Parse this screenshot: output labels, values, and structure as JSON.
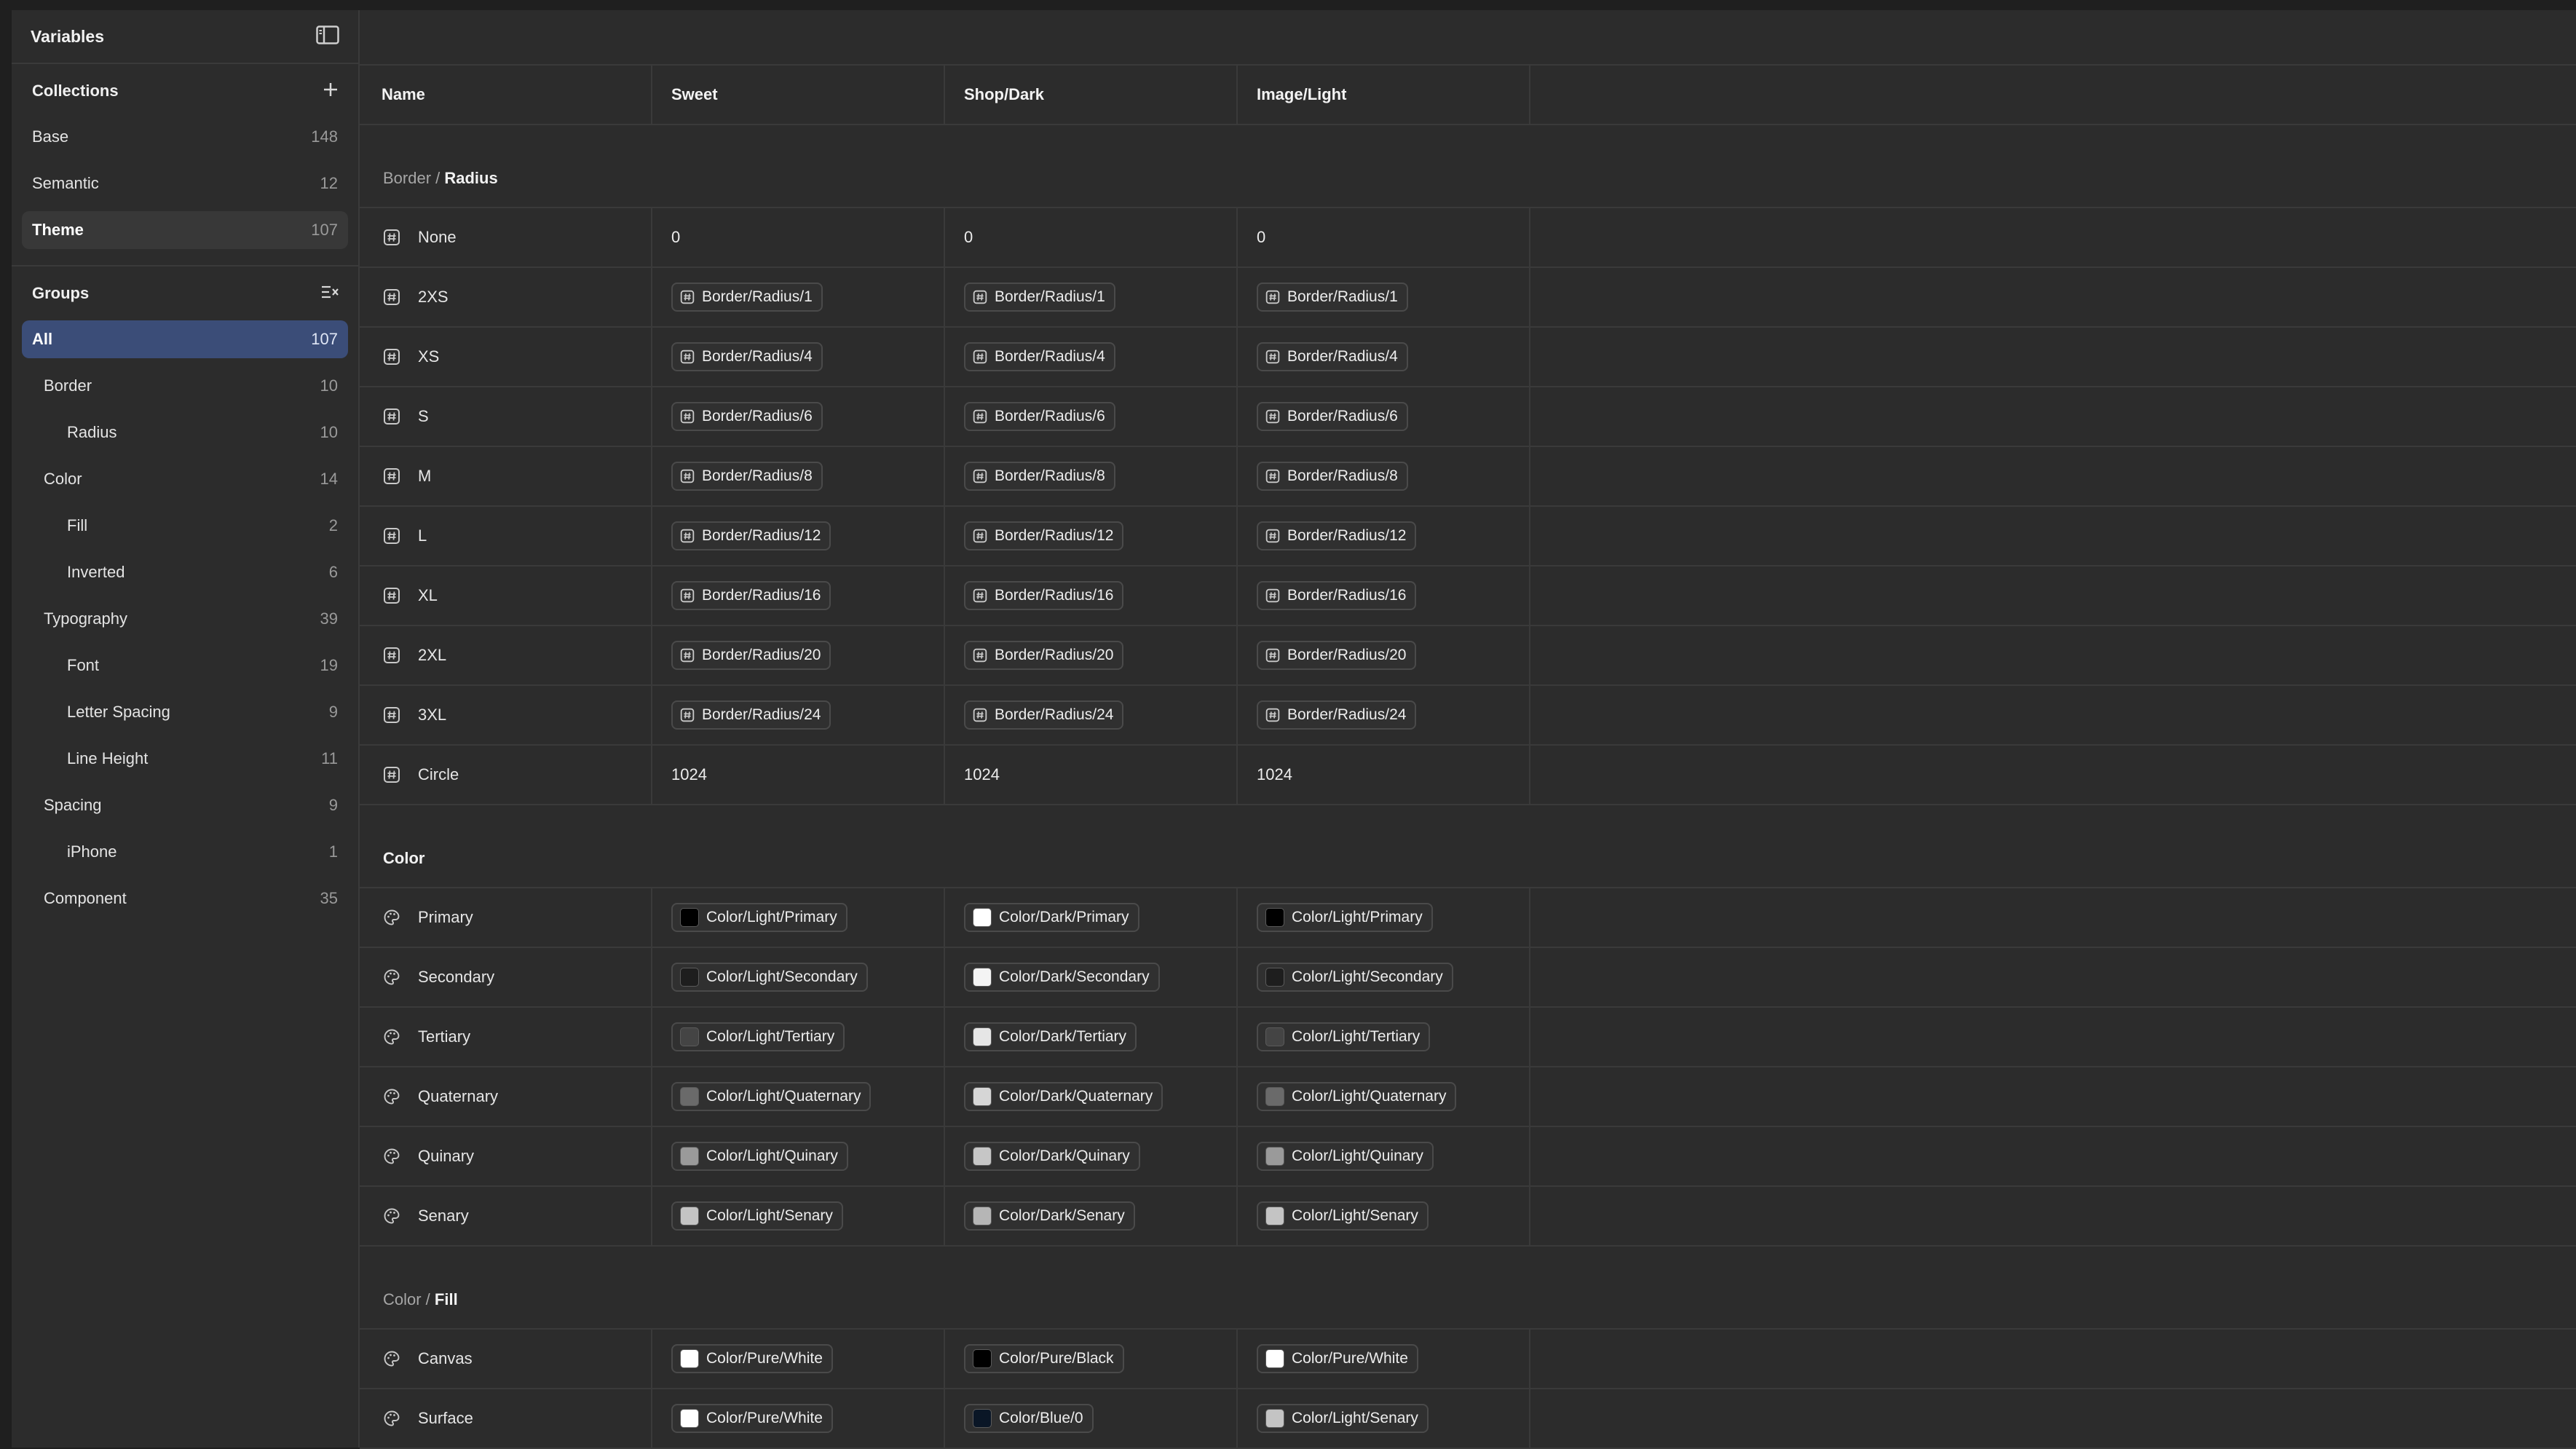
{
  "sidebar": {
    "title": "Variables",
    "collections_label": "Collections",
    "collections": [
      {
        "label": "Base",
        "count": "148"
      },
      {
        "label": "Semantic",
        "count": "12"
      },
      {
        "label": "Theme",
        "count": "107"
      }
    ],
    "groups_label": "Groups",
    "groups": [
      {
        "label": "All",
        "count": "107"
      },
      {
        "label": "Border",
        "count": "10"
      },
      {
        "label": "Radius",
        "count": "10"
      },
      {
        "label": "Color",
        "count": "14"
      },
      {
        "label": "Fill",
        "count": "2"
      },
      {
        "label": "Inverted",
        "count": "6"
      },
      {
        "label": "Typography",
        "count": "39"
      },
      {
        "label": "Font",
        "count": "19"
      },
      {
        "label": "Letter Spacing",
        "count": "9"
      },
      {
        "label": "Line Height",
        "count": "11"
      },
      {
        "label": "Spacing",
        "count": "9"
      },
      {
        "label": "iPhone",
        "count": "1"
      },
      {
        "label": "Component",
        "count": "35"
      }
    ]
  },
  "table": {
    "columns": [
      "Name",
      "Sweet",
      "Shop/Dark",
      "Image/Light"
    ],
    "sections": [
      {
        "path": "Border / ",
        "leaf": "Radius",
        "rows": [
          {
            "name": "None",
            "values": [
              "0",
              "0",
              "0"
            ]
          },
          {
            "name": "2XS",
            "values": [
              "Border/Radius/1",
              "Border/Radius/1",
              "Border/Radius/1"
            ]
          },
          {
            "name": "XS",
            "values": [
              "Border/Radius/4",
              "Border/Radius/4",
              "Border/Radius/4"
            ]
          },
          {
            "name": "S",
            "values": [
              "Border/Radius/6",
              "Border/Radius/6",
              "Border/Radius/6"
            ]
          },
          {
            "name": "M",
            "values": [
              "Border/Radius/8",
              "Border/Radius/8",
              "Border/Radius/8"
            ]
          },
          {
            "name": "L",
            "values": [
              "Border/Radius/12",
              "Border/Radius/12",
              "Border/Radius/12"
            ]
          },
          {
            "name": "XL",
            "values": [
              "Border/Radius/16",
              "Border/Radius/16",
              "Border/Radius/16"
            ]
          },
          {
            "name": "2XL",
            "values": [
              "Border/Radius/20",
              "Border/Radius/20",
              "Border/Radius/20"
            ]
          },
          {
            "name": "3XL",
            "values": [
              "Border/Radius/24",
              "Border/Radius/24",
              "Border/Radius/24"
            ]
          },
          {
            "name": "Circle",
            "values": [
              "1024",
              "1024",
              "1024"
            ]
          }
        ]
      },
      {
        "path": "",
        "leaf": "Color",
        "rows": [
          {
            "name": "Primary",
            "values": [
              "Color/Light/Primary",
              "Color/Dark/Primary",
              "Color/Light/Primary"
            ],
            "swatches": [
              "#000000",
              "#ffffff",
              "#000000"
            ]
          },
          {
            "name": "Secondary",
            "values": [
              "Color/Light/Secondary",
              "Color/Dark/Secondary",
              "Color/Light/Secondary"
            ],
            "swatches": [
              "#1e1e1e",
              "#f4f4f4",
              "#1e1e1e"
            ]
          },
          {
            "name": "Tertiary",
            "values": [
              "Color/Light/Tertiary",
              "Color/Dark/Tertiary",
              "Color/Light/Tertiary"
            ],
            "swatches": [
              "#444444",
              "#e6e6e6",
              "#444444"
            ]
          },
          {
            "name": "Quaternary",
            "values": [
              "Color/Light/Quaternary",
              "Color/Dark/Quaternary",
              "Color/Light/Quaternary"
            ],
            "swatches": [
              "#6a6a6a",
              "#d6d6d6",
              "#6a6a6a"
            ]
          },
          {
            "name": "Quinary",
            "values": [
              "Color/Light/Quinary",
              "Color/Dark/Quinary",
              "Color/Light/Quinary"
            ],
            "swatches": [
              "#9a9a9a",
              "#c6c6c6",
              "#9a9a9a"
            ]
          },
          {
            "name": "Senary",
            "values": [
              "Color/Light/Senary",
              "Color/Dark/Senary",
              "Color/Light/Senary"
            ],
            "swatches": [
              "#c4c4c4",
              "#b6b6b6",
              "#c4c4c4"
            ]
          }
        ]
      },
      {
        "path": "Color / ",
        "leaf": "Fill",
        "rows": [
          {
            "name": "Canvas",
            "values": [
              "Color/Pure/White",
              "Color/Pure/Black",
              "Color/Pure/White"
            ],
            "swatches": [
              "#ffffff",
              "#000000",
              "#ffffff"
            ]
          },
          {
            "name": "Surface",
            "values": [
              "Color/Pure/White",
              "Color/Blue/0",
              "Color/Light/Senary"
            ],
            "swatches": [
              "#ffffff",
              "#0a1626",
              "#c4c4c4"
            ]
          }
        ]
      }
    ]
  }
}
